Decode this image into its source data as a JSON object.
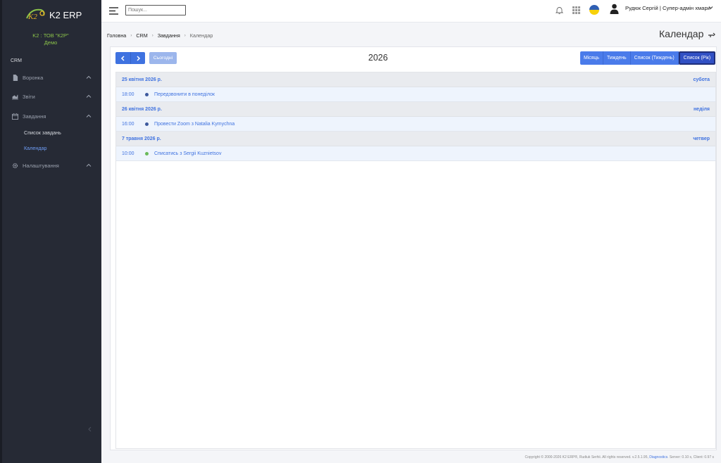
{
  "app": {
    "name": "K2 ERP",
    "company": "K2 : ТОВ \"К2Р\"",
    "environment": "Демо"
  },
  "sidebar": {
    "section": "CRM",
    "items": [
      {
        "label": "Воронка",
        "icon": "file-icon"
      },
      {
        "label": "Звіти",
        "icon": "chart-icon"
      },
      {
        "label": "Завдання",
        "icon": "calendar-icon"
      },
      {
        "label": "Налаштування",
        "icon": "gear-icon"
      }
    ],
    "subitems": [
      {
        "label": "Список завдань",
        "active": false
      },
      {
        "label": "Календар",
        "active": true
      }
    ]
  },
  "topbar": {
    "search_placeholder": "Пошук...",
    "user": "Рудюк Сергій | Супер-адмін хмари",
    "language": "UA"
  },
  "breadcrumb": [
    "Головна",
    "CRM",
    "Завдання",
    "Календар"
  ],
  "page_title": "Календар",
  "calendar": {
    "title": "2026",
    "today_label": "Сьогодні",
    "views": [
      {
        "label": "Місяць",
        "active": false
      },
      {
        "label": "Тиждень",
        "active": false
      },
      {
        "label": "Список (Тиждень)",
        "active": false
      },
      {
        "label": "Список (Рік)",
        "active": true
      }
    ],
    "days": [
      {
        "date": "25 квітня 2026 р.",
        "weekday": "субота",
        "events": [
          {
            "time": "18:00",
            "title": "Передзвонити в понеділок",
            "color": "#3d5a9e"
          }
        ]
      },
      {
        "date": "26 квітня 2026 р.",
        "weekday": "неділя",
        "events": [
          {
            "time": "16:00",
            "title": "Провести Zoom з Natalia Kymychna",
            "color": "#3d5a9e"
          }
        ]
      },
      {
        "date": "7 травня 2026 р.",
        "weekday": "четвер",
        "events": [
          {
            "time": "10:00",
            "title": "Списатись з Sergii Kuznietsov",
            "color": "#6aba5a"
          }
        ]
      }
    ]
  },
  "footer": {
    "copyright": "Copyright © 2000-2026 K2 ERP®, Rudiuk Serhii. All rights reserved. v.2.5.1.95,",
    "diagnostics": "Diagnostics",
    "timing": ". Server: 0.10 s, Client: 0.97 s"
  }
}
